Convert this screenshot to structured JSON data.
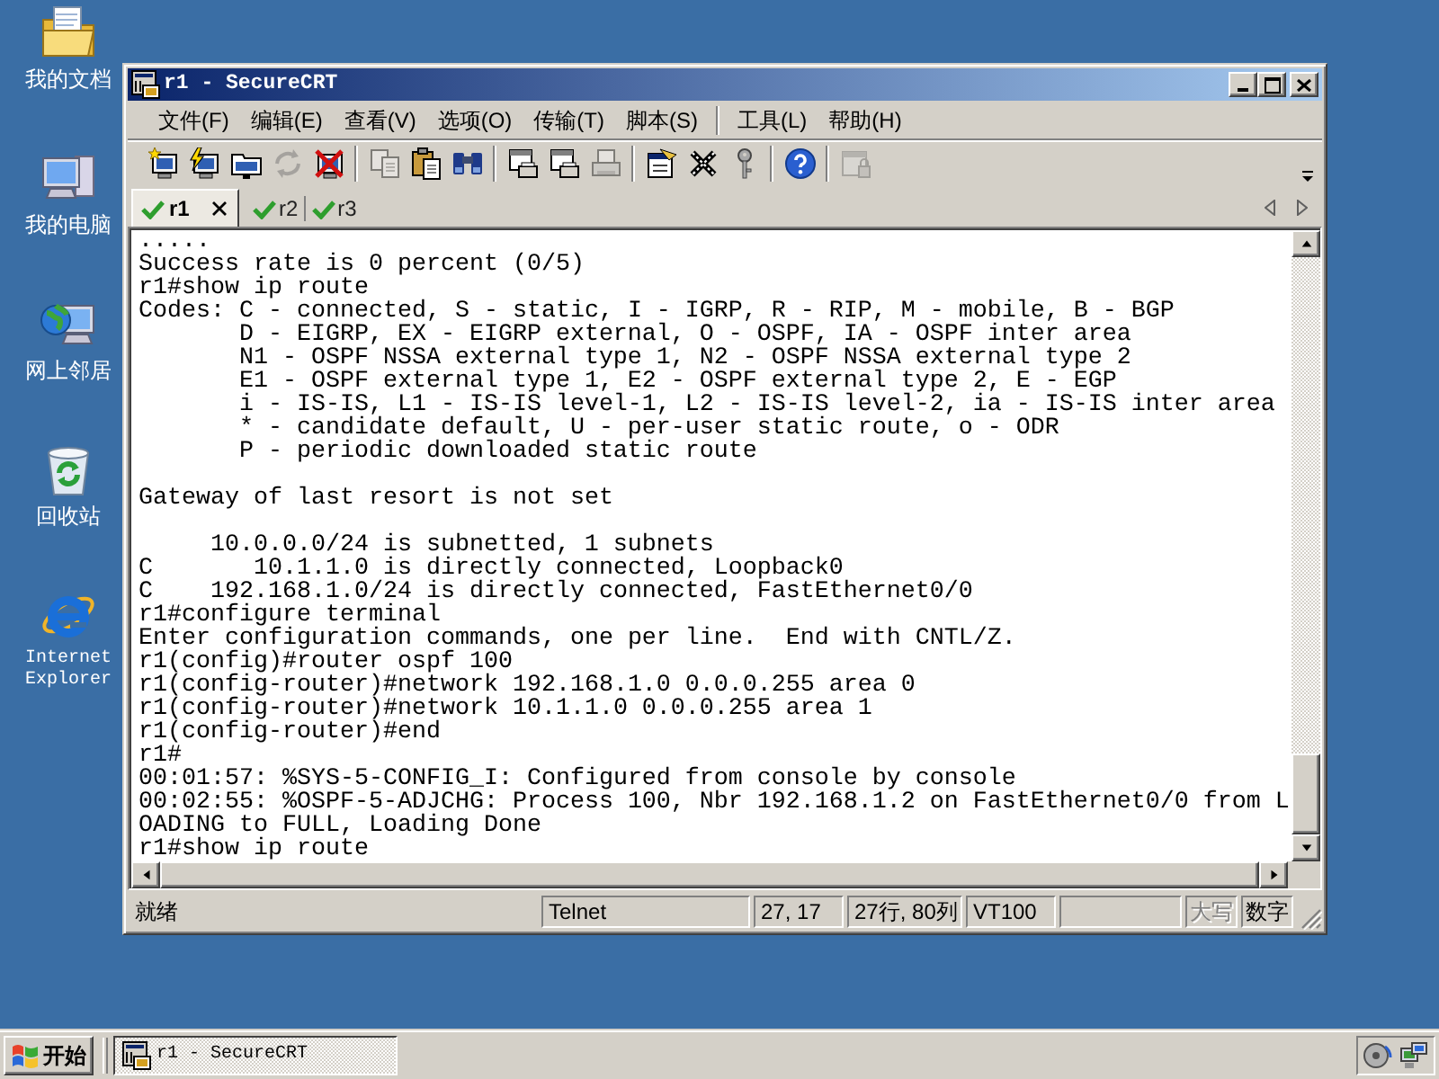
{
  "desktop_icons": [
    {
      "kind": "documents",
      "label": "我的文档"
    },
    {
      "kind": "computer",
      "label": "我的电脑"
    },
    {
      "kind": "network",
      "label": "网上邻居"
    },
    {
      "kind": "recycle_bin",
      "label": "回收站"
    },
    {
      "kind": "browser",
      "label": "Internet Explorer"
    }
  ],
  "window": {
    "title": "r1 - SecureCRT",
    "menu_groups": [
      {
        "items": [
          "文件(F)",
          "编辑(E)",
          "查看(V)",
          "选项(O)",
          "传输(T)",
          "脚本(S)"
        ]
      },
      {
        "items": [
          "工具(L)",
          "帮助(H)"
        ]
      }
    ],
    "toolbar_groups": [
      {
        "buttons": [
          {
            "kind": "connect",
            "disabled": false
          },
          {
            "kind": "quick_connect",
            "disabled": false
          },
          {
            "kind": "connect_tab",
            "disabled": false
          },
          {
            "kind": "reconnect",
            "disabled": true
          },
          {
            "kind": "disconnect",
            "disabled": false
          }
        ]
      },
      {
        "buttons": [
          {
            "kind": "copy",
            "disabled": true
          },
          {
            "kind": "paste",
            "disabled": false
          },
          {
            "kind": "find",
            "disabled": false
          }
        ]
      },
      {
        "buttons": [
          {
            "kind": "print_window",
            "disabled": false
          },
          {
            "kind": "print_window",
            "disabled": false
          },
          {
            "kind": "print",
            "disabled": true
          }
        ]
      },
      {
        "buttons": [
          {
            "kind": "properties",
            "disabled": false
          },
          {
            "kind": "tools",
            "disabled": false
          },
          {
            "kind": "key",
            "disabled": false
          }
        ]
      },
      {
        "buttons": [
          {
            "kind": "help",
            "disabled": false
          }
        ]
      },
      {
        "buttons": [
          {
            "kind": "lock",
            "disabled": true
          }
        ]
      }
    ],
    "tabs": [
      {
        "label": "r1",
        "selected": true,
        "connected": true
      },
      {
        "label": "r2",
        "selected": false,
        "connected": true
      },
      {
        "label": "r3",
        "selected": false,
        "connected": true
      }
    ],
    "terminal": {
      "blocks": [
        {
          "lines": [
            ".....",
            "Success rate is 0 percent (0/5)",
            "r1#show ip route",
            "Codes: C - connected, S - static, I - IGRP, R - RIP, M - mobile, B - BGP",
            "       D - EIGRP, EX - EIGRP external, O - OSPF, IA - OSPF inter area",
            "       N1 - OSPF NSSA external type 1, N2 - OSPF NSSA external type 2",
            "       E1 - OSPF external type 1, E2 - OSPF external type 2, E - EGP",
            "       i - IS-IS, L1 - IS-IS level-1, L2 - IS-IS level-2, ia - IS-IS inter area",
            "       * - candidate default, U - per-user static route, o - ODR",
            "       P - periodic downloaded static route"
          ]
        },
        {
          "lines": [
            "Gateway of last resort is not set"
          ]
        },
        {
          "lines": [
            "     10.0.0.0/24 is subnetted, 1 subnets",
            "C       10.1.1.0 is directly connected, Loopback0",
            "C    192.168.1.0/24 is directly connected, FastEthernet0/0",
            "r1#configure terminal",
            "Enter configuration commands, one per line.  End with CNTL/Z.",
            "r1(config)#router ospf 100",
            "r1(config-router)#network 192.168.1.0 0.0.0.255 area 0",
            "r1(config-router)#network 10.1.1.0 0.0.0.255 area 1",
            "r1(config-router)#end",
            "r1#",
            "00:01:57: %SYS-5-CONFIG_I: Configured from console by console",
            "00:02:55: %OSPF-5-ADJCHG: Process 100, Nbr 192.168.1.2 on FastEthernet0/0 from L",
            "OADING to FULL, Loading Done",
            "r1#show ip route"
          ]
        }
      ]
    },
    "status_bar": {
      "message": "就绪",
      "panels": [
        "Telnet",
        "27, 17",
        "27行, 80列",
        "VT100"
      ],
      "indicators": [
        {
          "text": "大写",
          "on": false
        },
        {
          "text": "数字",
          "on": true
        }
      ]
    }
  },
  "taskbar": {
    "start_label": "开始",
    "tasks": [
      {
        "label": "r1 - SecureCRT",
        "selected": true
      }
    ]
  }
}
